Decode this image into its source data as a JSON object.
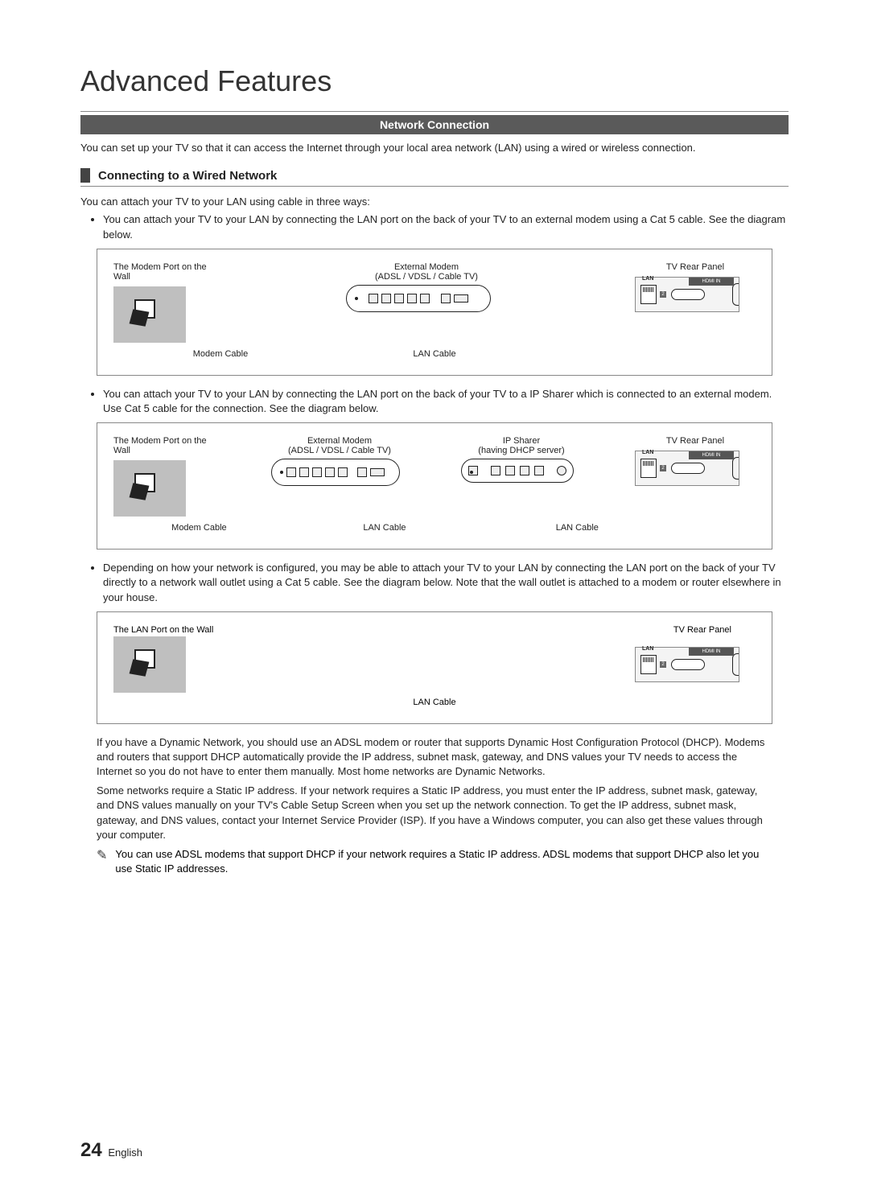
{
  "title": "Advanced Features",
  "section_banner": "Network Connection",
  "intro": "You can set up your TV so that it can access the Internet through your local area network (LAN) using a wired or wireless connection.",
  "subsection_title": "Connecting to a Wired Network",
  "lead_text": "You can attach your TV to your LAN using cable in three ways:",
  "bullets": {
    "b1": "You can attach your TV to your LAN by connecting the LAN port on the back of your TV to an external modem using a Cat 5 cable. See the diagram below.",
    "b2": "You can attach your TV to your LAN by connecting the LAN port on the back of your TV to a IP Sharer which is connected to an external modem. Use Cat 5 cable for the connection. See the diagram below.",
    "b3": "Depending on how your network is configured, you may be able to attach your TV to your LAN by connecting the LAN port on the back of your TV directly to a network wall outlet using a Cat 5 cable. See the diagram below. Note that the wall outlet is attached to a modem or router elsewhere in your house."
  },
  "diagram1": {
    "wall_label": "The Modem Port on the Wall",
    "modem_top": "External Modem",
    "modem_sub": "(ADSL / VDSL / Cable TV)",
    "tv_label": "TV Rear Panel",
    "cable1": "Modem Cable",
    "cable2": "LAN Cable",
    "lan": "LAN",
    "hdmi": "HDMI IN"
  },
  "diagram2": {
    "wall_label": "The Modem Port on the Wall",
    "modem_top": "External Modem",
    "modem_sub": "(ADSL / VDSL / Cable TV)",
    "sharer_top": "IP Sharer",
    "sharer_sub": "(having DHCP server)",
    "tv_label": "TV Rear Panel",
    "cable1": "Modem Cable",
    "cable2": "LAN Cable",
    "cable3": "LAN Cable",
    "lan": "LAN",
    "hdmi": "HDMI IN"
  },
  "diagram3": {
    "wall_label": "The LAN Port on the Wall",
    "tv_label": "TV Rear Panel",
    "cable1": "LAN Cable",
    "lan": "LAN",
    "hdmi": "HDMI IN"
  },
  "para1": "If you have a Dynamic Network, you should use an ADSL modem or router that supports Dynamic Host Configuration Protocol (DHCP). Modems and routers that support DHCP automatically provide the IP address, subnet mask, gateway, and DNS values your TV needs to access the Internet so you do not have to enter them manually. Most home networks are Dynamic Networks.",
  "para2": "Some networks require a Static IP address. If your network requires a Static IP address, you must enter the IP address, subnet mask, gateway, and DNS values manually on your TV's Cable Setup Screen when you set up the network connection. To get the IP address, subnet mask, gateway, and DNS values, contact your Internet Service Provider (ISP). If you have a Windows computer, you can also get these values through your computer.",
  "note": "You can use ADSL modems that support DHCP if your network requires a Static IP address. ADSL modems that support DHCP also let you use Static IP addresses.",
  "footer": {
    "page": "24",
    "lang": "English"
  }
}
